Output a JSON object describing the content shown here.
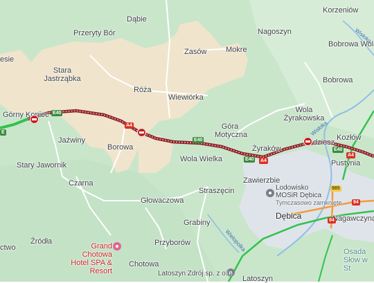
{
  "places": {
    "korzeniow": "Korzeniów",
    "dabie": "Dąbie",
    "przeryty_bor": "Przeryty Bór",
    "zasow": "Zasów",
    "mokre": "Mokre",
    "nagoszyn": "Nagoszyn",
    "bobrowa_wola": "Bobrowa Wola",
    "bobrowa": "Bobrowa",
    "lesie": "esie",
    "stara_jastrzabka": "Stara Jastrząbka",
    "roza": "Róża",
    "wiewiorka": "Wiewiórka",
    "gorny_koniec": "Górny Koniec",
    "wola_zyrakowska": "Wola Żyrakowska",
    "gora_motyczna": "Góra Motyczna",
    "jazwiny": "Jaźwiny",
    "borowa": "Borowa",
    "zyrakow": "Żyraków",
    "kozlow": "Kozłów",
    "pustynia": "Pustynia",
    "dziesz": "dziesz",
    "stary_jaworniki": "Stary Jawornik",
    "wola_wielka": "Wola Wielka",
    "zawierzbie": "Zawierzbie",
    "czarna": "Czarna",
    "straszecin": "Straszęcin",
    "glowaczowa": "Głowaczowa",
    "grabiny": "Grabiny",
    "debica": "Dębica",
    "nagawczyna": "Nagawczyna",
    "przyborow": "Przyborów",
    "zrodla": "Źródła",
    "chotowa": "Chotowa",
    "ctwo": "ctwo",
    "latoszyn": "Latoszyn",
    "osada": "Osada Słow w St"
  },
  "pois": {
    "mosir": "Lodowisko MOSiR Dębica",
    "mosir_sub": "Tymczasowo zamknięte",
    "hotel": "Grand Chotowa Hotel SPA & Resort",
    "latoszyn_zdroj": "Latoszyn Zdrój sp. z o.o."
  },
  "rivers": {
    "wisloka_ne": "Wisłoka",
    "wisloka_s": "Wisłoka",
    "wielopolka": "Wielopolka"
  },
  "shields": {
    "e40_a": "E40",
    "a4_a": "A4",
    "e40_b": "E40",
    "a4_b": "A4",
    "e40_c": "E40",
    "a4_c": "A4",
    "e40_d": "E40",
    "r985": "985",
    "r94_a": "94",
    "r94_b": "94",
    "e_left": "E"
  },
  "map_colors": {
    "land": "#cfe8cf",
    "forest": "#bfe1c3",
    "open_area": "#f1e6d0",
    "urban": "#dde3ea",
    "water": "#9cc3e6",
    "traffic_heavy": "#a5262e",
    "traffic_free": "#32c24d",
    "traffic_slow": "#f29c38",
    "incident": "#c5221f"
  }
}
